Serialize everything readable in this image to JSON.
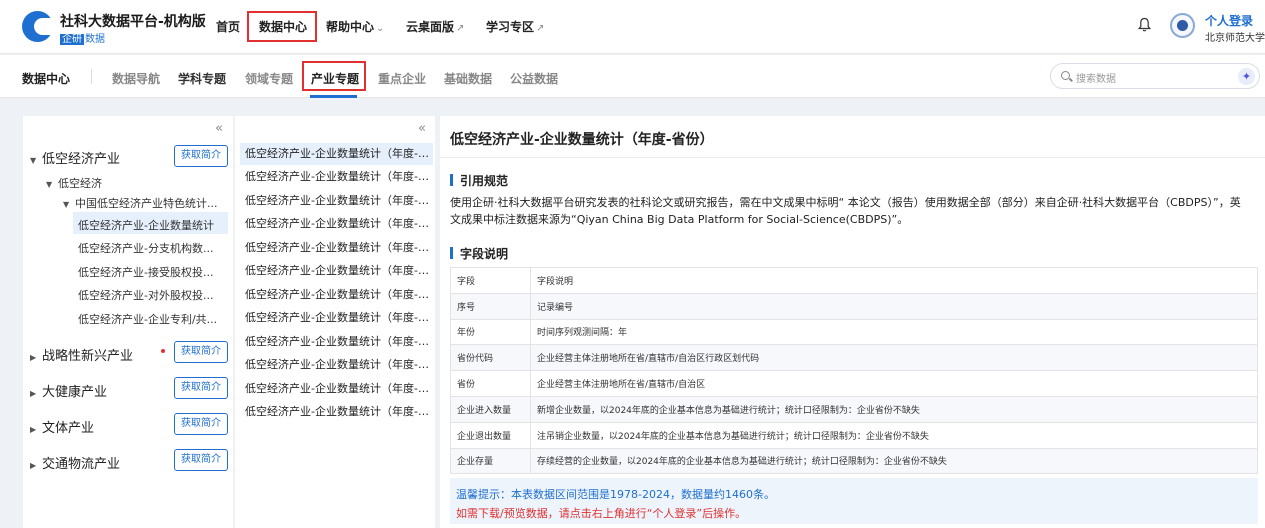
{
  "header": {
    "brand_title": "社科大数据平台-机构版",
    "brand_chip": "企研",
    "brand_tail": "数据",
    "nav": [
      {
        "label": "首页",
        "arrow": ""
      },
      {
        "label": "数据中心",
        "arrow": ""
      },
      {
        "label": "帮助中心",
        "arrow": "⌄"
      },
      {
        "label": "云桌面版",
        "arrow": "↗"
      },
      {
        "label": "学习专区",
        "arrow": "↗"
      }
    ],
    "login": "个人登录",
    "org": "北京师范大学"
  },
  "subnav": {
    "title": "数据中心",
    "items": [
      "数据导航",
      "学科专题",
      "领域专题",
      "产业专题",
      "重点企业",
      "基础数据",
      "公益数据"
    ],
    "active": "产业专题",
    "search_placeholder": "搜索数据"
  },
  "tree": {
    "collapse": "«",
    "intro_label": "获取简介",
    "nodes": [
      {
        "label": "低空经济产业",
        "expanded": true
      },
      {
        "label": "低空经济"
      },
      {
        "label": "中国低空经济产业特色统计..."
      },
      {
        "label": "低空经济产业-企业数量统计"
      },
      {
        "label": "低空经济产业-分支机构数..."
      },
      {
        "label": "低空经济产业-接受股权投..."
      },
      {
        "label": "低空经济产业-对外股权投..."
      },
      {
        "label": "低空经济产业-企业专利/共..."
      },
      {
        "label": "战略性新兴产业"
      },
      {
        "label": "大健康产业"
      },
      {
        "label": "文体产业"
      },
      {
        "label": "交通物流产业"
      }
    ]
  },
  "mid_list": {
    "collapse": "«",
    "items": [
      "低空经济产业-企业数量统计（年度-省份）",
      "低空经济产业-企业数量统计（年度-城市）",
      "低空经济产业-企业数量统计（年度-区县）",
      "低空经济产业-企业数量统计（年度-行业）",
      "低空经济产业-企业数量统计（年度-省份-行业）",
      "低空经济产业-企业数量统计（年度-城市-行业）",
      "低空经济产业-企业数量统计（年度-区县-行业）",
      "低空经济产业-企业数量统计（年度-注册资本）",
      "低空经济产业-企业数量统计（年度-企业类型）",
      "低空经济产业-企业数量统计（年度-登记状态）",
      "低空经济产业-企业数量统计（年度-省份-类型）",
      "低空经济产业-企业数量统计（年度-城市-类型）"
    ]
  },
  "main": {
    "title": "低空经济产业-企业数量统计（年度-省份）",
    "cite_heading": "引用规范",
    "cite_text": "使用企研·社科大数据平台研究发表的社科论文或研究报告，需在中文成果中标明“ 本论文（报告）使用数据全部（部分）来自企研·社科大数据平台（CBDPS）”，英文成果中标注数据来源为“Qiyan China Big Data Platform for Social-Science(CBDPS)”。",
    "fields_heading": "字段说明",
    "fields": [
      {
        "k": "字段",
        "v": "字段说明"
      },
      {
        "k": "序号",
        "v": "记录编号"
      },
      {
        "k": "年份",
        "v": "时间序列观测间隔：年"
      },
      {
        "k": "省份代码",
        "v": "企业经营主体注册地所在省/直辖市/自治区行政区划代码"
      },
      {
        "k": "省份",
        "v": "企业经营主体注册地所在省/直辖市/自治区"
      },
      {
        "k": "企业进入数量",
        "v": "新增企业数量，以2024年底的企业基本信息为基础进行统计；统计口径限制为：企业省份不缺失"
      },
      {
        "k": "企业退出数量",
        "v": "注吊销企业数量，以2024年底的企业基本信息为基础进行统计；统计口径限制为：企业省份不缺失"
      },
      {
        "k": "企业存量",
        "v": "存续经营的企业数量，以2024年底的企业基本信息为基础进行统计；统计口径限制为：企业省份不缺失"
      }
    ],
    "tip1": "温馨提示：本表数据区间范围是1978-2024，数据量约1460条。",
    "tip2": "如需下载/预览数据，请点击右上角进行“个人登录”后操作。"
  }
}
